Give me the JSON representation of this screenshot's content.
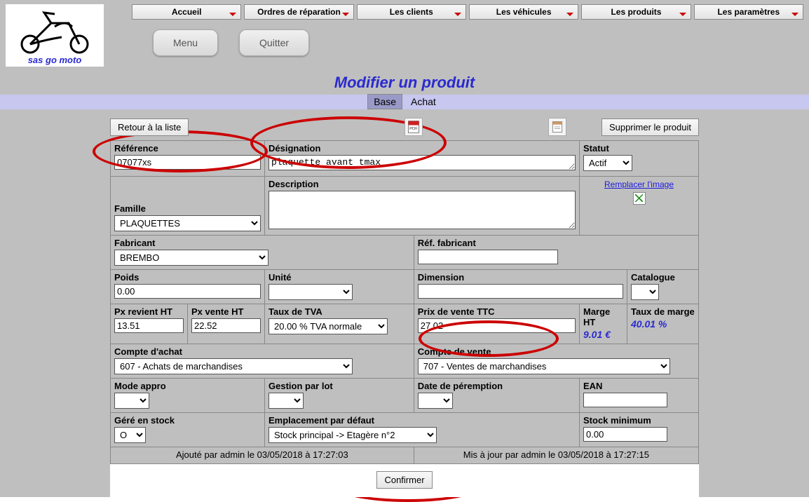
{
  "brand": "sas go moto",
  "nav": [
    "Accueil",
    "Ordres de réparation",
    "Les clients",
    "Les véhicules",
    "Les produits",
    "Les paramètres"
  ],
  "buttons": {
    "menu": "Menu",
    "quit": "Quitter"
  },
  "page_title": "Modifier un produit",
  "tabs": {
    "base": "Base",
    "achat": "Achat"
  },
  "actions": {
    "back": "Retour à la liste",
    "delete": "Supprimer le produit",
    "confirm": "Confirmer"
  },
  "labels": {
    "reference": "Référence",
    "designation": "Désignation",
    "statut": "Statut",
    "famille": "Famille",
    "description": "Description",
    "replace_image": "Remplacer l'image",
    "fabricant": "Fabricant",
    "ref_fabricant": "Réf. fabricant",
    "poids": "Poids",
    "unite": "Unité",
    "dimension": "Dimension",
    "catalogue": "Catalogue",
    "px_revient_ht": "Px revient HT",
    "px_vente_ht": "Px vente HT",
    "taux_tva": "Taux de TVA",
    "prix_vente_ttc": "Prix de vente TTC",
    "marge_ht": "Marge HT",
    "taux_marge": "Taux de marge",
    "compte_achat": "Compte d'achat",
    "compte_vente": "Compte de vente",
    "mode_appro": "Mode appro",
    "gestion_lot": "Gestion par lot",
    "date_peremption": "Date de péremption",
    "ean": "EAN",
    "gere_stock": "Géré en stock",
    "emplacement": "Emplacement par défaut",
    "stock_min": "Stock minimum"
  },
  "values": {
    "reference": "07077xs",
    "designation": "plaquette avant tmax",
    "statut": "Actif",
    "famille": "PLAQUETTES",
    "description": "",
    "fabricant": "BREMBO",
    "ref_fabricant": "",
    "poids": "0.00",
    "unite": "",
    "dimension": "",
    "catalogue": "",
    "px_revient_ht": "13.51",
    "px_vente_ht": "22.52",
    "taux_tva": "20.00 % TVA normale",
    "prix_vente_ttc": "27.02",
    "marge_ht": "9.01 €",
    "taux_marge": "40.01 %",
    "compte_achat": "607 - Achats de marchandises",
    "compte_vente": "707 - Ventes de marchandises",
    "mode_appro": "",
    "gestion_lot": "",
    "date_peremption": "",
    "ean": "",
    "gere_stock": "O",
    "emplacement": "Stock principal -> Etagère n°2",
    "stock_min": "0.00"
  },
  "audit": {
    "created": "Ajouté par admin le 03/05/2018 à 17:27:03",
    "updated": "Mis à jour par admin le 03/05/2018 à 17:27:15"
  }
}
